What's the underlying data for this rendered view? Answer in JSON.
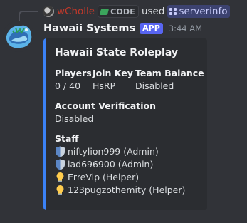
{
  "reply": {
    "username": "wCholle",
    "badge": "CODE",
    "used": "used",
    "command": "serverinfo"
  },
  "header": {
    "bot_name": "Hawaii Systems",
    "app_badge": "APP",
    "timestamp": "3:44 AM"
  },
  "embed": {
    "accent_color": "#3b82f6",
    "title": "Hawaii State Roleplay",
    "fields": {
      "players": {
        "name": "Players",
        "value": "0 / 40"
      },
      "join_key": {
        "name": "Join Key",
        "value": "HsRP"
      },
      "team_balance": {
        "name": "Team Balance",
        "value": "Disabled"
      },
      "account_verification": {
        "name": "Account Verification",
        "value": "Disabled"
      }
    },
    "staff": {
      "name": "Staff",
      "members": [
        {
          "label": "niftylion999 (Admin)",
          "icon": "shield-icon"
        },
        {
          "label": "lad696900 (Admin)",
          "icon": "shield-icon"
        },
        {
          "label": "ErreVip (Helper)",
          "icon": "lightbulb-icon"
        },
        {
          "label": "123pugzothemity (Helper)",
          "icon": "lightbulb-icon"
        }
      ]
    }
  }
}
